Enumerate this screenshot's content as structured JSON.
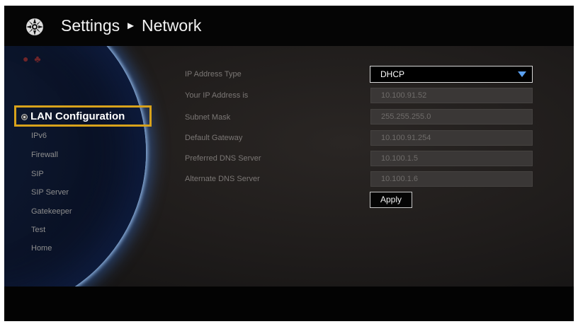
{
  "header": {
    "title": "Settings",
    "separator": "►",
    "subtitle": "Network",
    "icon": "settings-globe-icon"
  },
  "sidebar": {
    "active_label": "LAN Configuration",
    "items": [
      {
        "label": "IPv6"
      },
      {
        "label": "Firewall"
      },
      {
        "label": "SIP"
      },
      {
        "label": "SIP Server"
      },
      {
        "label": "Gatekeeper"
      },
      {
        "label": "Test"
      },
      {
        "label": "Home"
      }
    ]
  },
  "form": {
    "ip_type": {
      "label": "IP Address Type",
      "value": "DHCP"
    },
    "ip_address": {
      "label": "Your IP Address is",
      "value": "10.100.91.52"
    },
    "subnet": {
      "label": "Subnet Mask",
      "value": "255.255.255.0"
    },
    "gateway": {
      "label": "Default Gateway",
      "value": "10.100.91.254"
    },
    "dns1": {
      "label": "Preferred DNS Server",
      "value": "10.100.1.5"
    },
    "dns2": {
      "label": "Alternate DNS Server",
      "value": "10.100.1.6"
    },
    "apply_label": "Apply"
  },
  "colors": {
    "highlight": "#d8a21b",
    "dropdown_arrow": "#5aa0f0",
    "background": "#1f1c1b"
  }
}
